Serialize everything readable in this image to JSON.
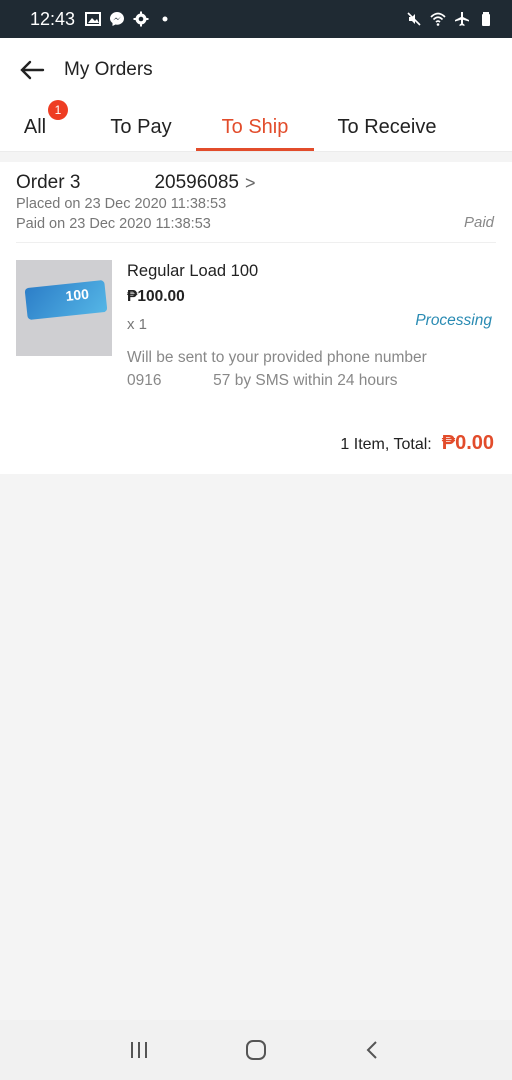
{
  "status_bar": {
    "time": "12:43",
    "left_icons": [
      "image-icon",
      "messenger-icon",
      "gear-icon",
      "dot-icon"
    ],
    "right_icons": [
      "mute-icon",
      "wifi-icon",
      "airplane-icon",
      "battery-icon"
    ]
  },
  "header": {
    "title": "My Orders",
    "back_icon": "arrow-left-icon"
  },
  "tabs": [
    {
      "label": "All",
      "badge": "1"
    },
    {
      "label": "To Pay"
    },
    {
      "label": "To Ship",
      "active": true
    },
    {
      "label": "To Receive"
    }
  ],
  "order": {
    "id_prefix": "Order ",
    "id_visible_start": "3",
    "id_visible_end": "20596085",
    "chevron": ">",
    "placed_on": "Placed on 23 Dec 2020  11:38:53",
    "paid_on": "Paid on 23 Dec 2020  11:38:53",
    "payment_status": "Paid",
    "item": {
      "name": "Regular Load 100",
      "price": "₱100.00",
      "quantity": "x 1",
      "status": "Processing",
      "note_line1": "Will be sent to your provided phone number",
      "note_line2": "0916            57 by SMS within 24 hours",
      "thumb_label": "100"
    },
    "total_label": "1 Item, Total:",
    "total_amount": "₱0.00"
  },
  "nav": {
    "recents_icon": "recents-icon",
    "home_icon": "home-icon",
    "back_icon": "back-chevron-icon"
  },
  "colors": {
    "accent": "#e24c2b",
    "processing": "#2a8bb3",
    "status_bar": "#1f2a33"
  }
}
